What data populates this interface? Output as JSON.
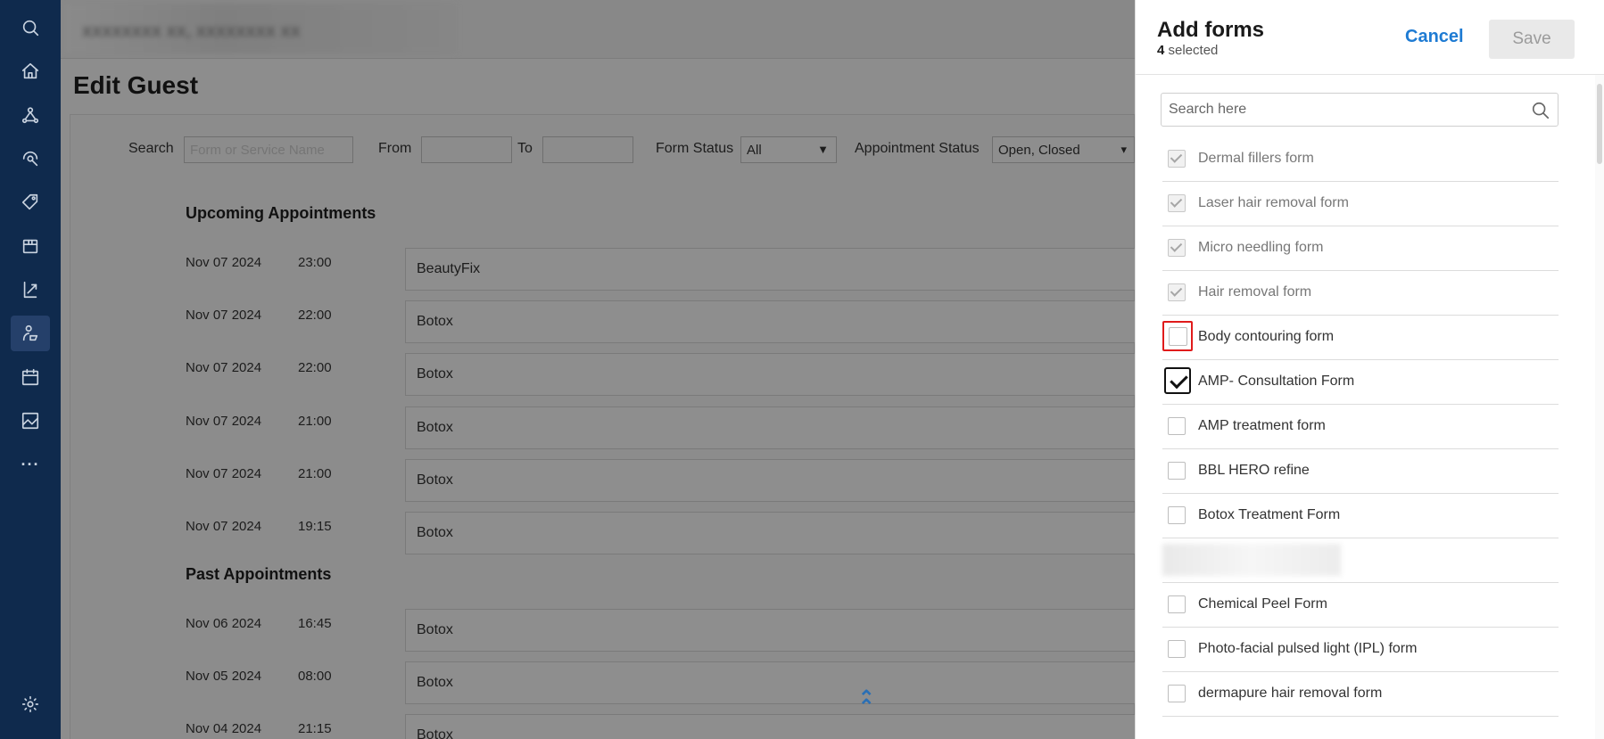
{
  "sidebar": {
    "icons": [
      "search-icon",
      "home-icon",
      "network-icon",
      "marketing-icon",
      "tag-icon",
      "inventory-icon",
      "reports-icon",
      "guest-icon",
      "calendar-icon",
      "image-icon",
      "more-icon",
      "settings-icon"
    ],
    "more_label": "···"
  },
  "header": {
    "blurred_title": "xxxxxxxx xx, xxxxxxxx xx"
  },
  "page": {
    "title": "Edit Guest"
  },
  "filters": {
    "search_label": "Search",
    "search_placeholder": "Form or Service Name",
    "from_label": "From",
    "to_label": "To",
    "form_status_label": "Form Status",
    "form_status_value": "All",
    "appointment_status_label": "Appointment Status",
    "appointment_status_value": "Open, Closed"
  },
  "upcoming": {
    "title": "Upcoming Appointments",
    "rows": [
      {
        "date": "Nov 07 2024",
        "time": "23:00",
        "service": "BeautyFix"
      },
      {
        "date": "Nov 07 2024",
        "time": "22:00",
        "service": "Botox"
      },
      {
        "date": "Nov 07 2024",
        "time": "22:00",
        "service": "Botox"
      },
      {
        "date": "Nov 07 2024",
        "time": "21:00",
        "service": "Botox"
      },
      {
        "date": "Nov 07 2024",
        "time": "21:00",
        "service": "Botox"
      },
      {
        "date": "Nov 07 2024",
        "time": "19:15",
        "service": "Botox"
      }
    ]
  },
  "past": {
    "title": "Past Appointments",
    "rows": [
      {
        "date": "Nov 06 2024",
        "time": "16:45",
        "service": "Botox"
      },
      {
        "date": "Nov 05 2024",
        "time": "08:00",
        "service": "Botox"
      },
      {
        "date": "Nov 04 2024",
        "time": "21:15",
        "service": "Botox"
      }
    ]
  },
  "panel": {
    "title": "Add forms",
    "selected_count": "4",
    "selected_suffix": " selected",
    "cancel_label": "Cancel",
    "save_label": "Save",
    "search_placeholder": "Search here",
    "forms": [
      {
        "label": "Dermal fillers form",
        "state": "disabled-checked"
      },
      {
        "label": "Laser hair removal form",
        "state": "disabled-checked"
      },
      {
        "label": "Micro needling form",
        "state": "disabled-checked"
      },
      {
        "label": "Hair removal form",
        "state": "disabled-checked"
      },
      {
        "label": "Body contouring form",
        "state": "focused"
      },
      {
        "label": "AMP- Consultation Form",
        "state": "checked"
      },
      {
        "label": "AMP treatment form",
        "state": "unchecked"
      },
      {
        "label": "BBL HERO refine",
        "state": "unchecked"
      },
      {
        "label": "Botox Treatment Form",
        "state": "unchecked"
      },
      {
        "label": "",
        "state": "redacted"
      },
      {
        "label": "Chemical Peel Form",
        "state": "unchecked"
      },
      {
        "label": "Photo-facial pulsed light (IPL) form",
        "state": "unchecked"
      },
      {
        "label": "dermapure hair removal form",
        "state": "unchecked"
      }
    ]
  },
  "colors": {
    "sidebar_bg": "#0f2a4d",
    "accent": "#1e7bd3",
    "focus_outline": "#e01b1b"
  }
}
